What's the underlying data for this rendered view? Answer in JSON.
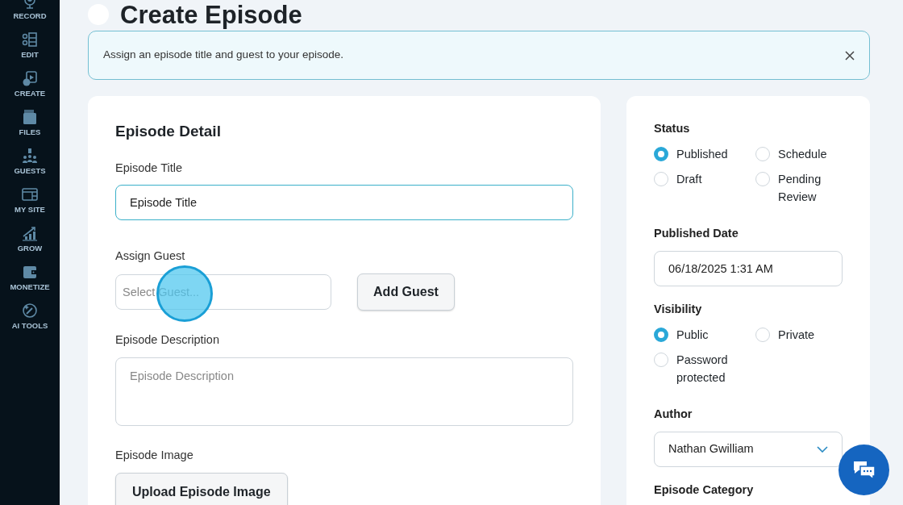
{
  "sidebar": {
    "items": [
      {
        "label": "RECORD"
      },
      {
        "label": "EDIT"
      },
      {
        "label": "CREATE"
      },
      {
        "label": "FILES"
      },
      {
        "label": "GUESTS"
      },
      {
        "label": "MY SITE"
      },
      {
        "label": "GROW"
      },
      {
        "label": "MONETIZE"
      },
      {
        "label": "AI TOOLS"
      }
    ]
  },
  "page": {
    "title": "Create Episode"
  },
  "alert": {
    "text": "Assign an episode title and guest to your episode."
  },
  "episode_detail": {
    "heading": "Episode Detail",
    "title_field": {
      "label": "Episode Title",
      "value": "Episode Title",
      "focused": true
    },
    "guest_field": {
      "label": "Assign Guest",
      "placeholder": "Select Guest..."
    },
    "add_guest_button": "Add Guest",
    "description_field": {
      "label": "Episode Description",
      "placeholder": "Episode Description"
    },
    "image": {
      "label": "Episode Image",
      "button": "Upload Episode Image"
    }
  },
  "settings": {
    "status": {
      "label": "Status",
      "options": [
        {
          "label": "Published",
          "selected": true
        },
        {
          "label": "Schedule",
          "selected": false
        },
        {
          "label": "Draft",
          "selected": false
        },
        {
          "label": "Pending Review",
          "selected": false
        }
      ]
    },
    "published_date": {
      "label": "Published Date",
      "value": "06/18/2025 1:31 AM"
    },
    "visibility": {
      "label": "Visibility",
      "options": [
        {
          "label": "Public",
          "selected": true
        },
        {
          "label": "Private",
          "selected": false
        },
        {
          "label": "Password protected",
          "selected": false
        }
      ]
    },
    "author": {
      "label": "Author",
      "value": "Nathan Gwilliam"
    },
    "category": {
      "label": "Episode Category"
    }
  }
}
